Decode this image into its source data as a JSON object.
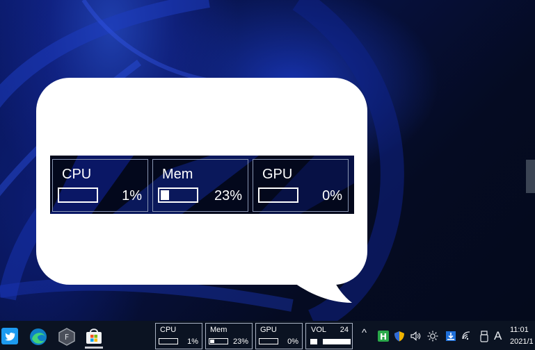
{
  "widget": {
    "meters": [
      {
        "label": "CPU",
        "value": "1%",
        "fill": 0.0
      },
      {
        "label": "Mem",
        "value": "23%",
        "fill": 0.23
      },
      {
        "label": "GPU",
        "value": "0%",
        "fill": 0.0
      }
    ]
  },
  "taskbar": {
    "apps": [
      "twitter-icon",
      "edge-icon",
      "app-hexagon-icon",
      "store-icon"
    ],
    "mini_meters": [
      {
        "label": "CPU",
        "value": "1%",
        "fill": 0.0
      },
      {
        "label": "Mem",
        "value": "23%",
        "fill": 0.23
      },
      {
        "label": "GPU",
        "value": "0%",
        "fill": 0.0
      }
    ],
    "volume": {
      "label": "VOL",
      "value": "24",
      "level": 0.24
    },
    "tray": {
      "chevron": "^",
      "icons": [
        "h-app-icon",
        "shield-icon",
        "speaker-icon",
        "brightness-icon",
        "download-icon",
        "wifi-icon",
        "usb-icon"
      ],
      "ime": "A"
    },
    "clock": {
      "time": "11:01",
      "date": "2021/1"
    }
  },
  "colors": {
    "accent": "#1f3fae",
    "taskbar": "#0b1322",
    "meter_border": "#8a97b3"
  }
}
